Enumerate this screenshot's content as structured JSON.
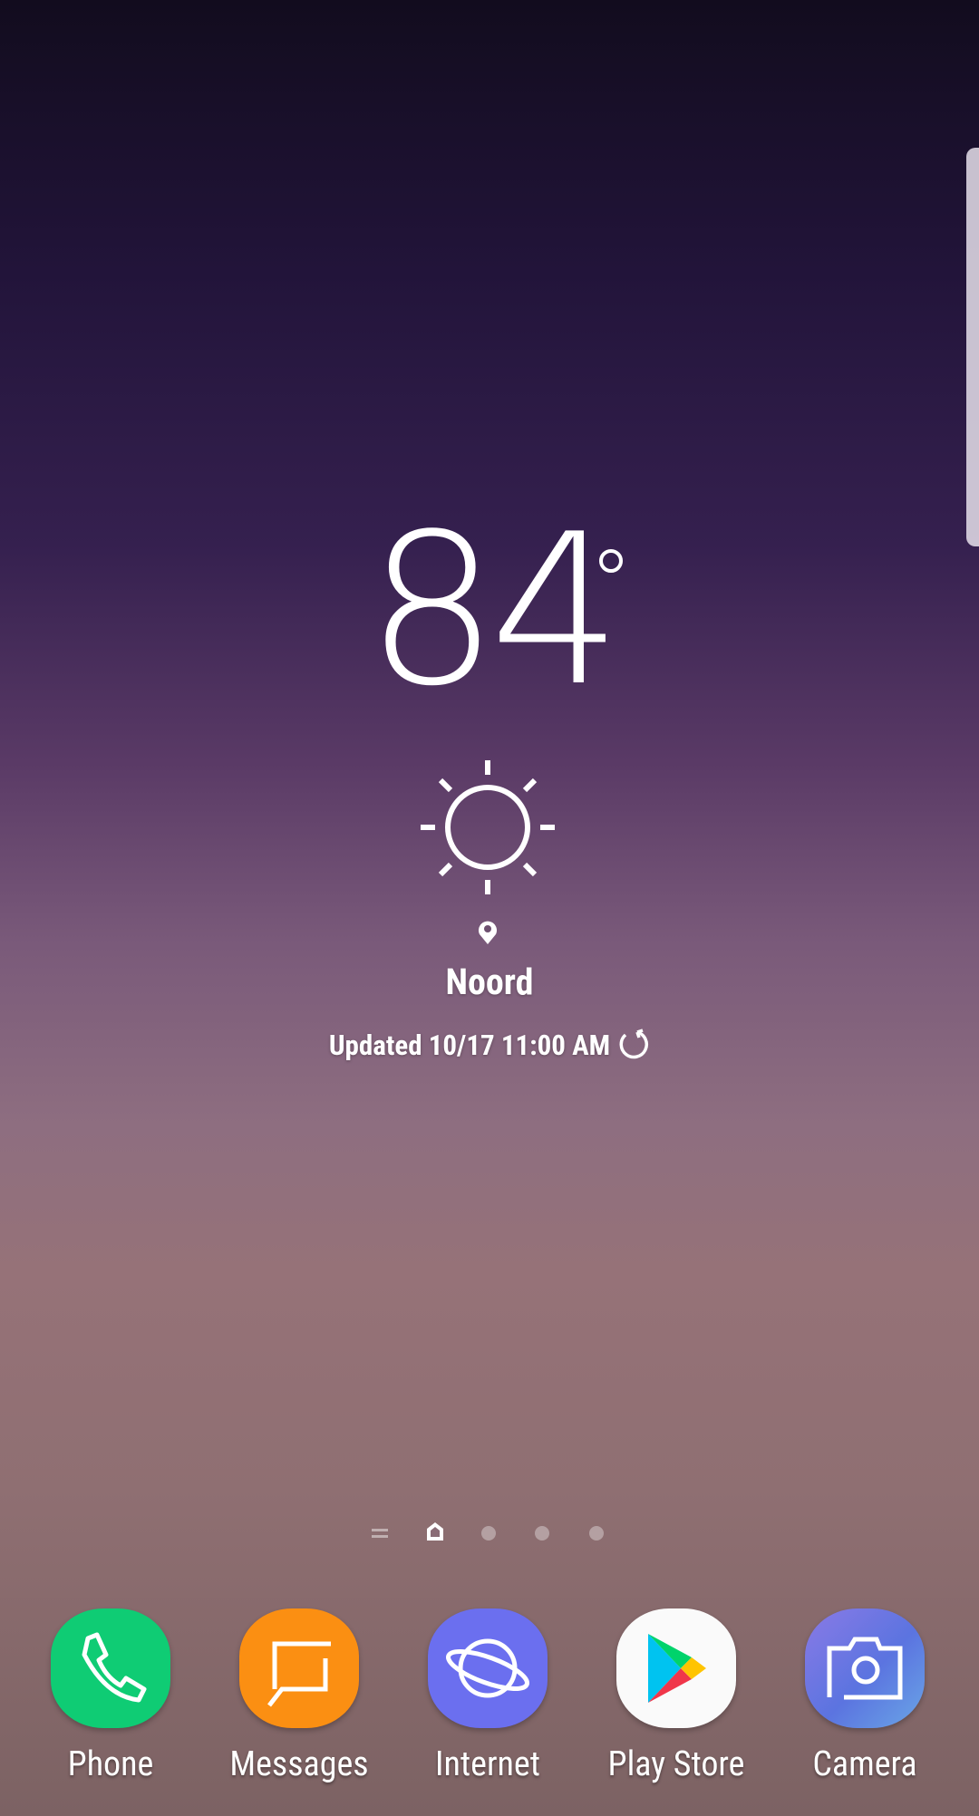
{
  "weather": {
    "temperature": "84",
    "unit_symbol": "°",
    "condition_icon": "sun-icon",
    "location": "Noord",
    "updated": "Updated 10/17 11:00 AM"
  },
  "page_indicator": {
    "pages": 5,
    "current": "home"
  },
  "dock": {
    "apps": [
      {
        "label": "Phone",
        "color": "#0fcc74"
      },
      {
        "label": "Messages",
        "color": "#fb8f12"
      },
      {
        "label": "Internet",
        "color": "#6b6fef"
      },
      {
        "label": "Play Store",
        "color": "#fafafa"
      },
      {
        "label": "Camera",
        "color": "#6a7fe8"
      }
    ]
  }
}
